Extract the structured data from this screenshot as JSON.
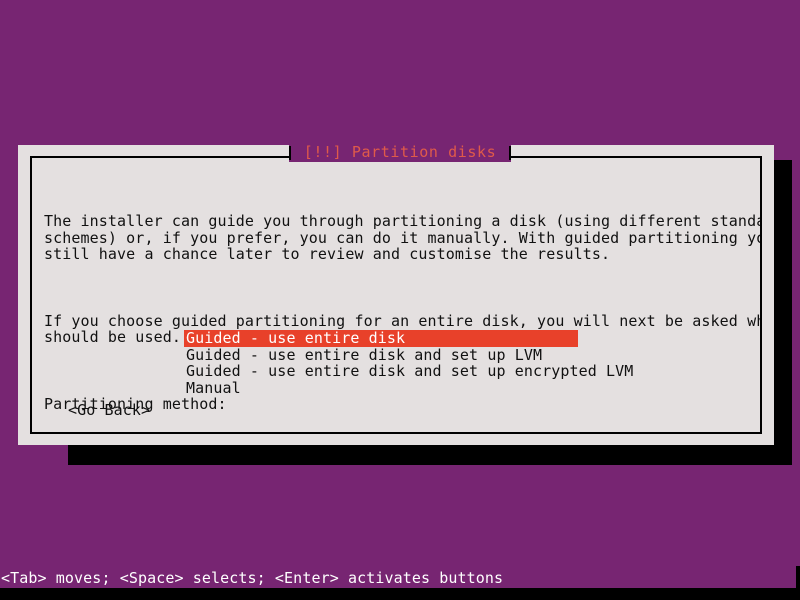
{
  "screen": {
    "background_color": "#772572",
    "text_color": "#ffffff"
  },
  "dialog": {
    "title": "[!!] Partition disks",
    "title_color": "#df5a4a",
    "background_color": "#e4e0e0",
    "border_color": "#000000",
    "paragraphs": [
      "The installer can guide you through partitioning a disk (using different standard\nschemes) or, if you prefer, you can do it manually. With guided partitioning you will\nstill have a chance later to review and customise the results.",
      "If you choose guided partitioning for an entire disk, you will next be asked which disk\nshould be used."
    ],
    "list_label": "Partitioning method:",
    "menu": {
      "selected_index": 0,
      "highlight_background": "#e8412a",
      "highlight_text_color": "#ffffff",
      "items": [
        "Guided - use entire disk",
        "Guided - use entire disk and set up LVM",
        "Guided - use entire disk and set up encrypted LVM",
        "Manual"
      ]
    },
    "buttons": [
      "<Go Back>"
    ]
  },
  "status_bar": {
    "text": "<Tab> moves; <Space> selects; <Enter> activates buttons"
  }
}
